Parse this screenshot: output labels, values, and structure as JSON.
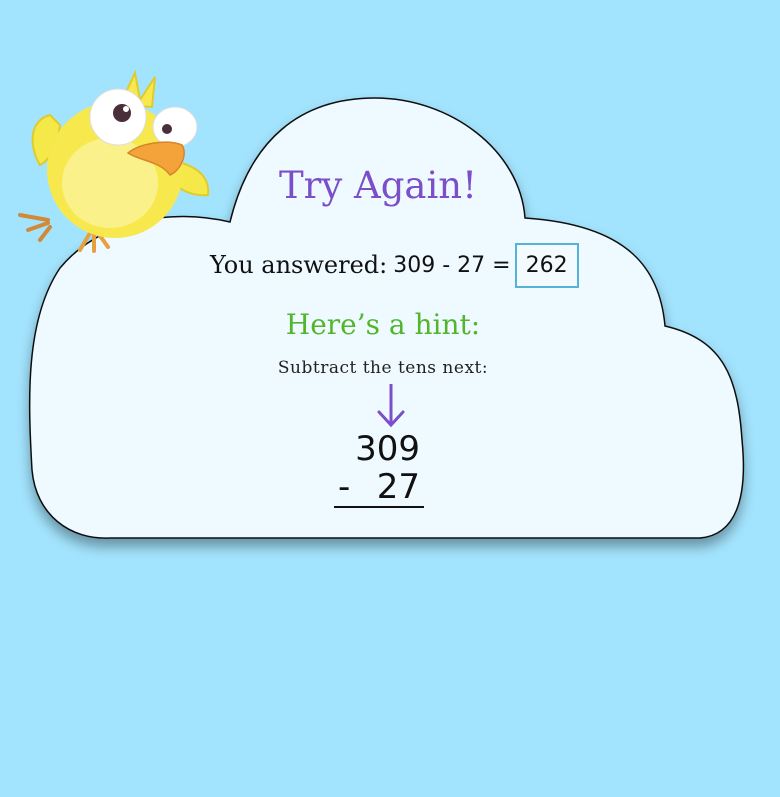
{
  "title": "Try Again!",
  "answer": {
    "prefix": "You answered:",
    "equation": "309 - 27 =",
    "value": "262"
  },
  "hint": {
    "title": "Here’s a hint:",
    "text": "Subtract the tens next:"
  },
  "problem": {
    "top": "309",
    "operator": "-",
    "bottom": "27"
  },
  "icons": {
    "arrow": "arrow-down-icon",
    "mascot": "chick-mascot"
  },
  "colors": {
    "background": "#a2e3fd",
    "title": "#7b4fc9",
    "hint": "#52b52c",
    "answer_border": "#56b3d6"
  }
}
